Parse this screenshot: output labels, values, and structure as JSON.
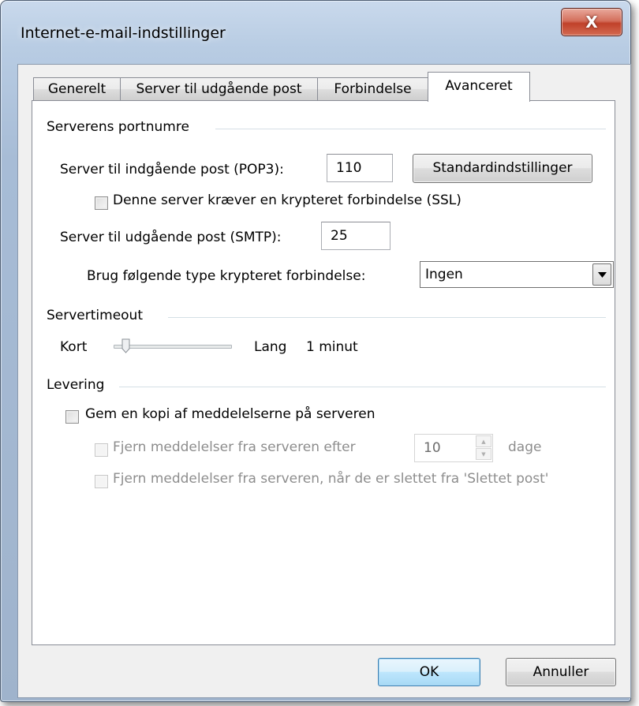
{
  "window": {
    "title": "Internet-e-mail-indstillinger",
    "close_glyph": "X"
  },
  "tabs": [
    {
      "label": "Generelt",
      "active": false
    },
    {
      "label": "Server til udgående post",
      "active": false
    },
    {
      "label": "Forbindelse",
      "active": false
    },
    {
      "label": "Avanceret",
      "active": true
    }
  ],
  "ports": {
    "group_label": "Serverens portnumre",
    "incoming_label": "Server til indgående post (POP3):",
    "incoming_value": "110",
    "defaults_button": "Standardindstillinger",
    "ssl_checkbox_label": "Denne server kræver en krypteret forbindelse (SSL)",
    "ssl_checked": false,
    "outgoing_label": "Server til udgående post (SMTP):",
    "outgoing_value": "25",
    "encryption_label": "Brug følgende type krypteret forbindelse:",
    "encryption_value": "Ingen"
  },
  "timeout": {
    "group_label": "Servertimeout",
    "short_label": "Kort",
    "long_label": "Lang",
    "value_text": "1 minut",
    "level": 0.0
  },
  "delivery": {
    "group_label": "Levering",
    "keep_copy_label": "Gem en kopi af meddelelserne på serveren",
    "keep_copy_checked": false,
    "remove_after_label": "Fjern meddelelser fra serveren efter",
    "remove_after_value": "10",
    "days_label": "dage",
    "remove_deleted_label": "Fjern meddelelser fra serveren, når de er slettet fra 'Slettet post'"
  },
  "buttons": {
    "ok": "OK",
    "cancel": "Annuller"
  },
  "colors": {
    "window_frame": "#b8cce3",
    "close_button": "#c7462d",
    "panel_background": "#ffffff",
    "client_background": "#f0f0f0"
  }
}
